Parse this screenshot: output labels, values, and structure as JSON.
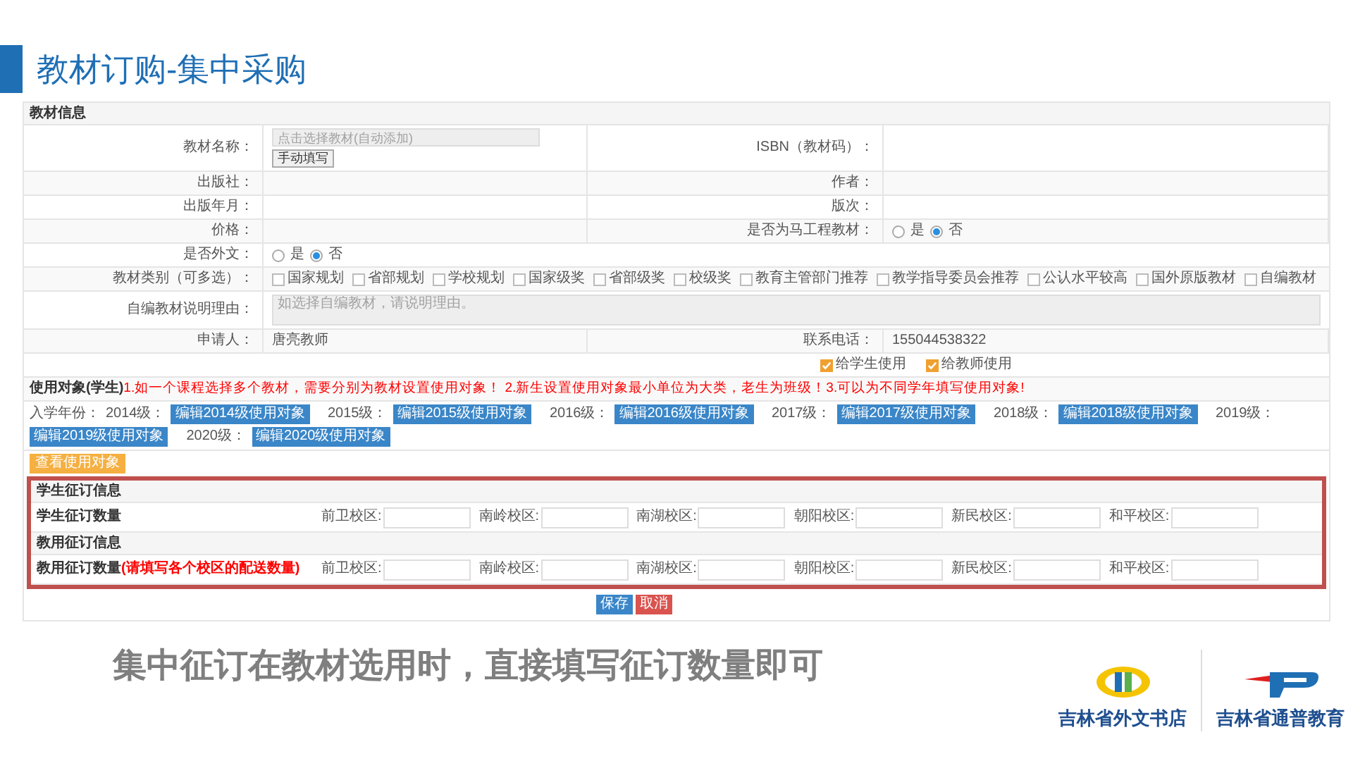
{
  "slide_title": "教材订购-集中采购",
  "form": {
    "section_title": "教材信息",
    "info_rows": [
      {
        "cells": [
          {
            "label": "教材名称：",
            "kind": "picker",
            "placeholder": "点击选择教材(自动添加)",
            "button": "手动填写"
          },
          {
            "label": "ISBN（教材码）：",
            "kind": "text"
          }
        ]
      },
      {
        "cells": [
          {
            "label": "出版社：",
            "kind": "text"
          },
          {
            "label": "作者：",
            "kind": "text"
          }
        ]
      },
      {
        "cells": [
          {
            "label": "出版年月：",
            "kind": "text"
          },
          {
            "label": "版次：",
            "kind": "text"
          }
        ]
      },
      {
        "cells": [
          {
            "label": "价格：",
            "kind": "text"
          },
          {
            "label": "是否为马工程教材：",
            "kind": "radio",
            "options": [
              {
                "label": "是",
                "selected": false
              },
              {
                "label": "否",
                "selected": true
              }
            ]
          }
        ]
      },
      {
        "cells": [
          {
            "label": "是否外文：",
            "kind": "radio",
            "options": [
              {
                "label": "是",
                "selected": false
              },
              {
                "label": "否",
                "selected": true
              }
            ]
          }
        ]
      },
      {
        "cells": [
          {
            "label": "教材类别（可多选）：",
            "kind": "checkboxes",
            "options": [
              {
                "label": "国家规划",
                "checked": false
              },
              {
                "label": "省部规划",
                "checked": false
              },
              {
                "label": "学校规划",
                "checked": false
              },
              {
                "label": "国家级奖",
                "checked": false
              },
              {
                "label": "省部级奖",
                "checked": false
              },
              {
                "label": "校级奖",
                "checked": false
              },
              {
                "label": "教育主管部门推荐",
                "checked": false
              },
              {
                "label": "教学指导委员会推荐",
                "checked": false
              },
              {
                "label": "公认水平较高",
                "checked": false
              },
              {
                "label": "国外原版教材",
                "checked": false
              },
              {
                "label": "自编教材",
                "checked": false
              }
            ]
          }
        ]
      },
      {
        "cells": [
          {
            "label": "自编教材说明理由：",
            "kind": "textarea",
            "placeholder": "如选择自编教材，请说明理由。"
          }
        ]
      },
      {
        "cells": [
          {
            "label": "申请人：",
            "kind": "text",
            "value": "唐亮教师"
          },
          {
            "label": "联系电话：",
            "kind": "text",
            "value": "155044538322"
          }
        ]
      }
    ],
    "usage": [
      {
        "label": "给学生使用",
        "checked": true
      },
      {
        "label": "给教师使用",
        "checked": true
      }
    ],
    "usage_note": {
      "label": "使用对象(学生)",
      "text": "1.如一个课程选择多个教材，需要分别为教材设置使用对象！ 2.新生设置使用对象最小单位为大类，老生为班级！3.可以为不同学年填写使用对象!"
    },
    "years": {
      "label": "入学年份：",
      "items": [
        {
          "label": "2014级：",
          "button": "编辑2014级使用对象"
        },
        {
          "label": "2015级：",
          "button": "编辑2015级使用对象"
        },
        {
          "label": "2016级：",
          "button": "编辑2016级使用对象"
        },
        {
          "label": "2017级：",
          "button": "编辑2017级使用对象"
        },
        {
          "label": "2018级：",
          "button": "编辑2018级使用对象"
        },
        {
          "label": "2019级：",
          "button": "编辑2019级使用对象"
        },
        {
          "label": "2020级：",
          "button": "编辑2020级使用对象"
        }
      ]
    },
    "view_button": "查看使用对象",
    "orders": [
      {
        "title": "学生征订信息",
        "label": "学生征订数量",
        "campuses": [
          "前卫校区:",
          "南岭校区:",
          "南湖校区:",
          "朝阳校区:",
          "新民校区:",
          "和平校区:"
        ]
      },
      {
        "title": "教用征订信息",
        "label": "教用征订数量",
        "note": "(请填写各个校区的配送数量)",
        "campuses": [
          "前卫校区:",
          "南岭校区:",
          "南湖校区:",
          "朝阳校区:",
          "新民校区:",
          "和平校区:"
        ]
      }
    ],
    "actions": [
      {
        "label": "保存",
        "kind": "primary"
      },
      {
        "label": "取消",
        "kind": "danger"
      }
    ]
  },
  "caption": "集中征订在教材选用时，直接填写征订数量即可",
  "logos": [
    {
      "label": "吉林省外文书店"
    },
    {
      "label": "吉林省通普教育"
    }
  ]
}
